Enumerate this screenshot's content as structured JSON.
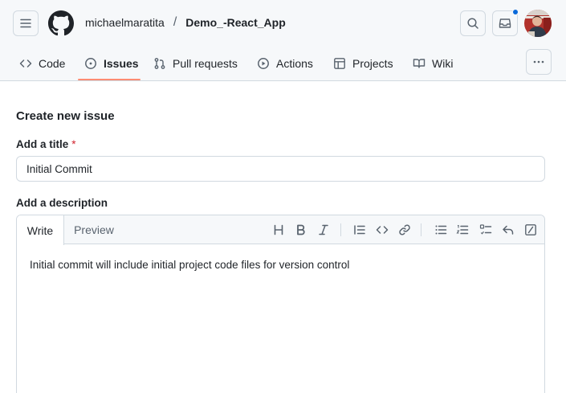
{
  "repo": {
    "owner": "michaelmaratita",
    "separator": "/",
    "name": "Demo_-React_App"
  },
  "nav_tabs": [
    {
      "label": "Code",
      "icon": "code-icon"
    },
    {
      "label": "Issues",
      "icon": "issue-opened-icon",
      "active": true
    },
    {
      "label": "Pull requests",
      "icon": "git-pull-request-icon"
    },
    {
      "label": "Actions",
      "icon": "play-icon"
    },
    {
      "label": "Projects",
      "icon": "table-icon"
    },
    {
      "label": "Wiki",
      "icon": "book-icon"
    }
  ],
  "form": {
    "page_title": "Create new issue",
    "title_label": "Add a title",
    "required_mark": "*",
    "title_value": "Initial Commit",
    "description_label": "Add a description",
    "tab_write": "Write",
    "tab_preview": "Preview",
    "description_value": "Initial commit will include initial project code files for version control"
  },
  "toolbar_icons": [
    "heading-icon",
    "bold-icon",
    "italic-icon",
    "quote-icon",
    "code-icon",
    "link-icon",
    "unordered-list-icon",
    "ordered-list-icon",
    "task-list-icon",
    "reply-icon",
    "slash-command-icon"
  ],
  "colors": {
    "accent_underline": "#fd8c73",
    "notification_dot": "#0969da",
    "required": "#d1242f"
  }
}
